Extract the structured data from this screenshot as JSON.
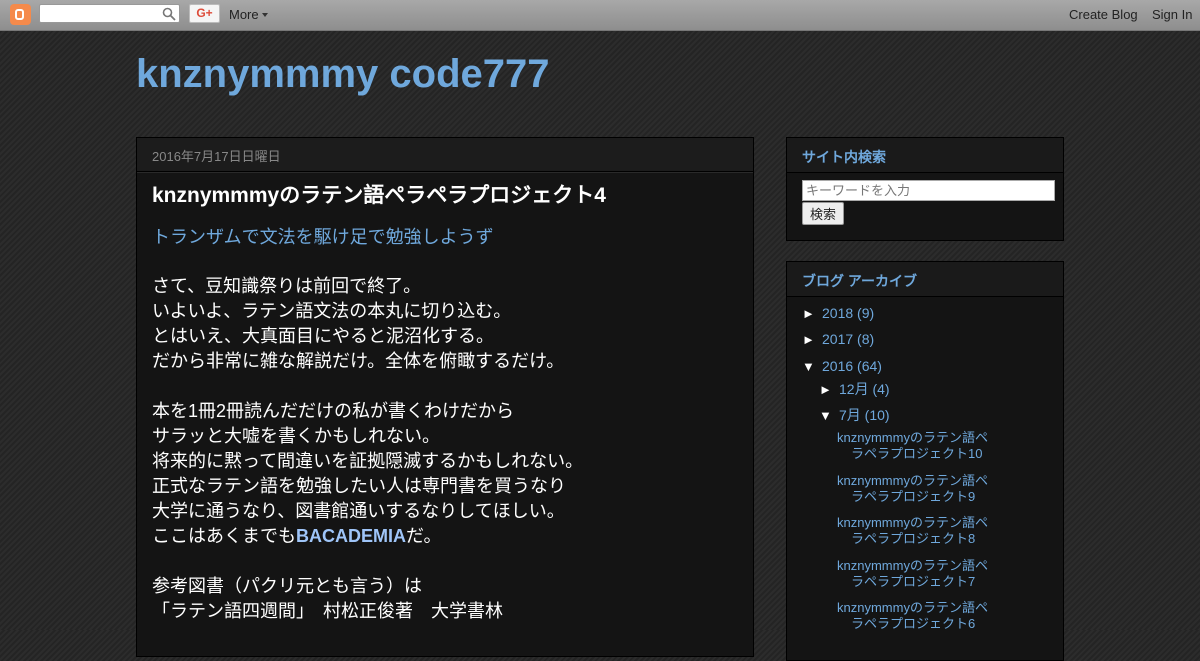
{
  "navbar": {
    "more_label": "More",
    "gplus_label": "G+",
    "create_blog_label": "Create Blog",
    "sign_in_label": "Sign In"
  },
  "blog": {
    "title": "knznymmmy code777"
  },
  "post": {
    "date": "2016年7月17日日曜日",
    "title": "knznymmmyのラテン語ペラペラプロジェクト4",
    "subtitle": "トランザムで文法を駆け足で勉強しようず",
    "paragraphs": [
      [
        "さて、豆知識祭りは前回で終了。",
        "いよいよ、ラテン語文法の本丸に切り込む。",
        "とはいえ、大真面目にやると泥沼化する。",
        "だから非常に雑な解説だけ。全体を俯瞰するだけ。"
      ],
      [
        "本を1冊2冊読んだだけの私が書くわけだから",
        "サラッと大嘘を書くかもしれない。",
        "将来的に黙って間違いを証拠隠滅するかもしれない。",
        "正式なラテン語を勉強したい人は専門書を買うなり",
        "大学に通うなり、図書館通いするなりしてほしい。"
      ],
      [
        "参考図書（パクリ元とも言う）は",
        "「ラテン語四週間」　村松正俊著　大学書林"
      ]
    ],
    "last_line_prefix": "ここはあくまでも",
    "last_line_link": "BACADEMIA",
    "last_line_suffix": "だ。"
  },
  "sidebar": {
    "search": {
      "title": "サイト内検索",
      "placeholder": "キーワードを入力",
      "button_label": "検索"
    },
    "archive": {
      "title": "ブログ アーカイブ",
      "years": [
        {
          "toggle": "►",
          "label": "2018 (9)"
        },
        {
          "toggle": "►",
          "label": "2017 (8)"
        },
        {
          "toggle": "▼",
          "label": "2016 (64)"
        }
      ],
      "months": [
        {
          "toggle": "►",
          "label": "12月 (4)"
        },
        {
          "toggle": "▼",
          "label": "7月 (10)"
        }
      ],
      "posts": [
        {
          "line1": "knznymmmyのラテン語ペ",
          "line2": "ラペラプロジェクト10"
        },
        {
          "line1": "knznymmmyのラテン語ペ",
          "line2": "ラペラプロジェクト9"
        },
        {
          "line1": "knznymmmyのラテン語ペ",
          "line2": "ラペラプロジェクト8"
        },
        {
          "line1": "knznymmmyのラテン語ペ",
          "line2": "ラペラプロジェクト7"
        },
        {
          "line1": "knznymmmyのラテン語ペ",
          "line2": "ラペラプロジェクト6"
        }
      ]
    }
  }
}
